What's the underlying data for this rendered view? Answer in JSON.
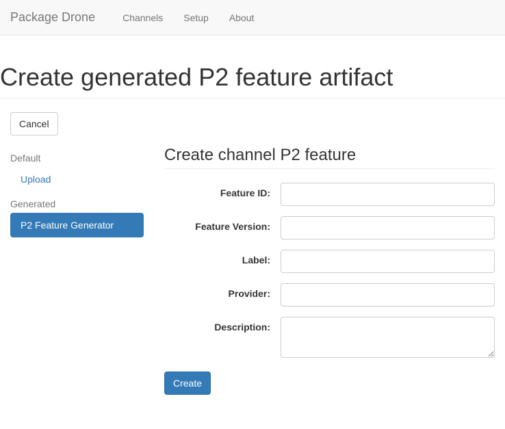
{
  "navbar": {
    "brand": "Package Drone",
    "items": [
      {
        "label": "Channels"
      },
      {
        "label": "Setup"
      },
      {
        "label": "About"
      }
    ]
  },
  "page_title": "Create generated P2 feature artifact",
  "toolbar": {
    "cancel_label": "Cancel"
  },
  "sidebar": {
    "groups": [
      {
        "header": "Default",
        "items": [
          {
            "label": "Upload",
            "active": false
          }
        ]
      },
      {
        "header": "Generated",
        "items": [
          {
            "label": "P2 Feature Generator",
            "active": true
          }
        ]
      }
    ]
  },
  "form": {
    "title": "Create channel P2 feature",
    "fields": {
      "feature_id": {
        "label": "Feature ID:",
        "value": ""
      },
      "feature_version": {
        "label": "Feature Version:",
        "value": ""
      },
      "label": {
        "label": "Label:",
        "value": ""
      },
      "provider": {
        "label": "Provider:",
        "value": ""
      },
      "description": {
        "label": "Description:",
        "value": ""
      }
    },
    "submit_label": "Create"
  }
}
